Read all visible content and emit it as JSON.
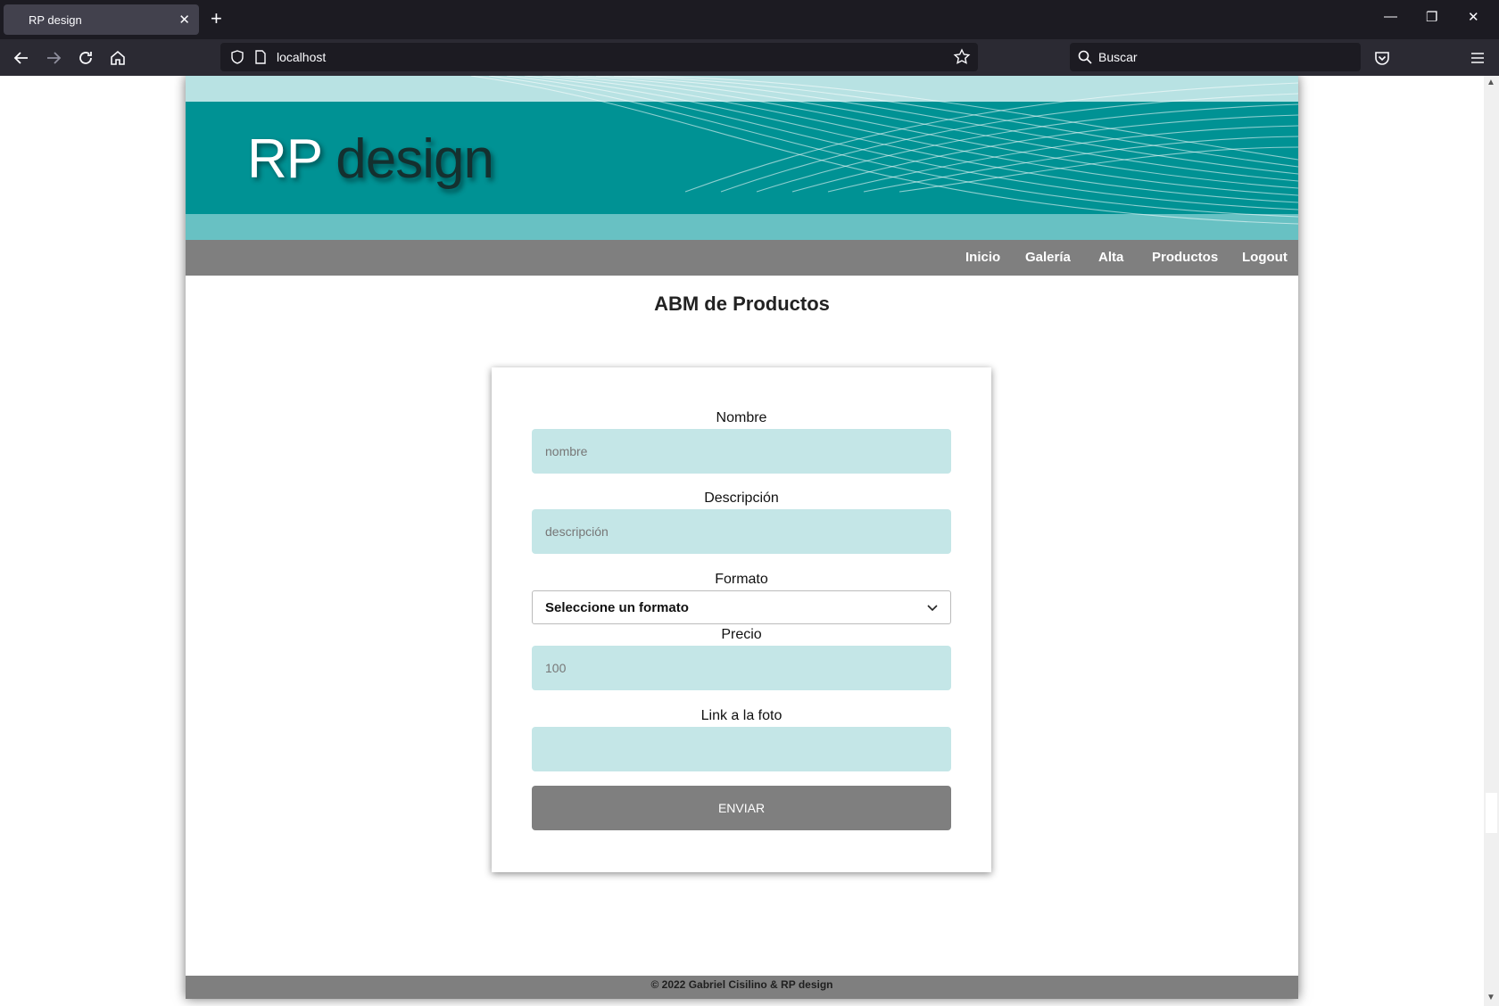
{
  "browser": {
    "tab_title": "RP design",
    "url": "localhost",
    "search_placeholder": "Buscar"
  },
  "site": {
    "brand_rp": "RP",
    "brand_design": "design",
    "menu": [
      "Inicio",
      "Galería",
      "Alta",
      "Productos",
      "Logout"
    ],
    "page_title": "ABM de Productos",
    "form": {
      "nombre_label": "Nombre",
      "nombre_placeholder": "nombre",
      "descripcion_label": "Descripción",
      "descripcion_placeholder": "descripción",
      "formato_label": "Formato",
      "formato_value": "Seleccione un formato",
      "precio_label": "Precio",
      "precio_placeholder": "100",
      "foto_label": "Link a la foto",
      "foto_placeholder": "",
      "submit_label": "ENVIAR"
    },
    "footer": "© 2022 Gabriel Cisilino & RP design"
  },
  "colors": {
    "header_teal": "#009294",
    "header_light": "#b8e2e3",
    "input_bg": "#c4e6e7",
    "menu_gray": "#7f7f7f"
  }
}
